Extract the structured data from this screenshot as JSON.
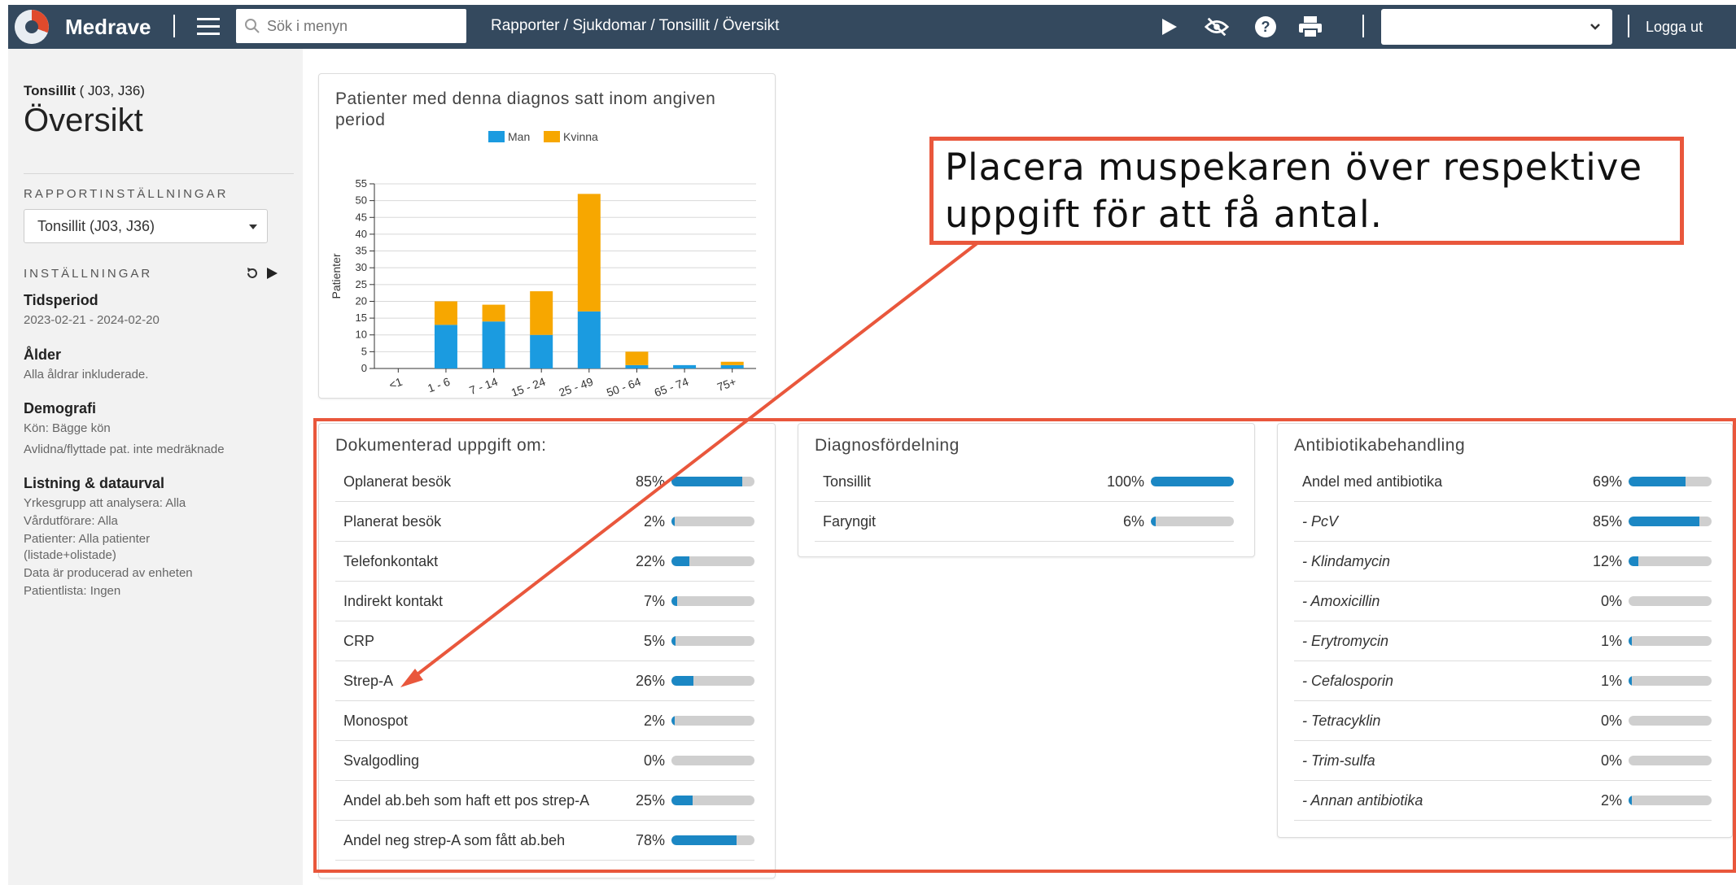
{
  "topbar": {
    "brand": "Medrave",
    "search_placeholder": "Sök i menyn",
    "breadcrumb": "Rapporter / Sjukdomar / Tonsillit / Översikt",
    "select_value": "",
    "logout": "Logga ut",
    "icons": [
      "play-icon",
      "eye-off-icon",
      "help-icon",
      "print-icon"
    ]
  },
  "sidebar": {
    "diagnosis_name": "Tonsillit",
    "diagnosis_codes": "( J03, J36)",
    "page_title": "Översikt",
    "report_settings_label": "RAPPORTINSTÄLLNINGAR",
    "report_select_value": "Tonsillit (J03, J36)",
    "settings_label": "INSTÄLLNINGAR",
    "period_heading": "Tidsperiod",
    "period_value": "2023-02-21 - 2024-02-20",
    "age_heading": "Ålder",
    "age_value": "Alla åldrar inkluderade.",
    "demo_heading": "Demografi",
    "demo_line1": "Kön: Bägge kön",
    "demo_line2": "Avlidna/flyttade pat. inte medräknade",
    "listing_heading": "Listning & dataurval",
    "listing_lines": [
      "Yrkesgrupp att analysera: Alla",
      "Vårdutförare: Alla",
      "Patienter: Alla patienter",
      "(listade+olistade)",
      "Data är producerad av enheten",
      "Patientlista: Ingen"
    ]
  },
  "chart_card": {
    "title_line1": "Patienter med denna diagnos satt inom angiven",
    "title_line2": "period"
  },
  "chart_data": {
    "type": "bar",
    "stacked": true,
    "categories": [
      "<1",
      "1 - 6",
      "7 - 14",
      "15 - 24",
      "25 - 49",
      "50 - 64",
      "65 - 74",
      "75+"
    ],
    "series": [
      {
        "name": "Man",
        "color": "#1b9be0",
        "values": [
          0,
          13,
          14,
          10,
          17,
          1,
          1,
          1
        ]
      },
      {
        "name": "Kvinna",
        "color": "#f7a700",
        "values": [
          0,
          7,
          5,
          13,
          35,
          4,
          0,
          1
        ]
      }
    ],
    "ylabel": "Patienter",
    "ylim": [
      0,
      55
    ],
    "yticks": [
      0,
      5,
      10,
      15,
      20,
      25,
      30,
      35,
      40,
      45,
      50,
      55
    ],
    "grid": true,
    "legend": "top-center"
  },
  "documented": {
    "title": "Dokumenterad uppgift om:",
    "rows": [
      {
        "label": "Oplanerat besök",
        "pct": "85%",
        "value": 0.85
      },
      {
        "label": "Planerat besök",
        "pct": "2%",
        "value": 0.02
      },
      {
        "label": "Telefonkontakt",
        "pct": "22%",
        "value": 0.22
      },
      {
        "label": "Indirekt kontakt",
        "pct": "7%",
        "value": 0.07
      },
      {
        "label": "CRP",
        "pct": "5%",
        "value": 0.05
      },
      {
        "label": "Strep-A",
        "pct": "26%",
        "value": 0.26
      },
      {
        "label": "Monospot",
        "pct": "2%",
        "value": 0.02
      },
      {
        "label": "Svalgodling",
        "pct": "0%",
        "value": 0
      },
      {
        "label": "Andel ab.beh som haft ett pos strep-A",
        "pct": "25%",
        "value": 0.25
      },
      {
        "label": "Andel neg strep-A som fått ab.beh",
        "pct": "78%",
        "value": 0.78
      }
    ]
  },
  "diagnosis_dist": {
    "title": "Diagnosfördelning",
    "rows": [
      {
        "label": "Tonsillit",
        "pct": "100%",
        "value": 1.0
      },
      {
        "label": "Faryngit",
        "pct": "6%",
        "value": 0.06
      }
    ]
  },
  "antibiotics": {
    "title": "Antibiotikabehandling",
    "rows": [
      {
        "label": "Andel med antibiotika",
        "pct": "69%",
        "value": 0.69,
        "italic": false
      },
      {
        "label": "- PcV",
        "pct": "85%",
        "value": 0.85,
        "italic": true
      },
      {
        "label": "- Klindamycin",
        "pct": "12%",
        "value": 0.12,
        "italic": true
      },
      {
        "label": "- Amoxicillin",
        "pct": "0%",
        "value": 0,
        "italic": true
      },
      {
        "label": "- Erytromycin",
        "pct": "1%",
        "value": 0.01,
        "italic": true
      },
      {
        "label": "- Cefalosporin",
        "pct": "1%",
        "value": 0.01,
        "italic": true
      },
      {
        "label": "- Tetracyklin",
        "pct": "0%",
        "value": 0,
        "italic": true
      },
      {
        "label": "- Trim-sulfa",
        "pct": "0%",
        "value": 0,
        "italic": true
      },
      {
        "label": "- Annan antibiotika",
        "pct": "2%",
        "value": 0.02,
        "italic": true
      }
    ]
  },
  "annotation": {
    "line1": "Placera muspekaren över respektive",
    "line2": "uppgift för att få antal.",
    "color": "#e9573c"
  },
  "colors": {
    "topbar": "#34495e",
    "bar_fill": "#1b87c4",
    "bar_track": "#cfcfcf"
  }
}
